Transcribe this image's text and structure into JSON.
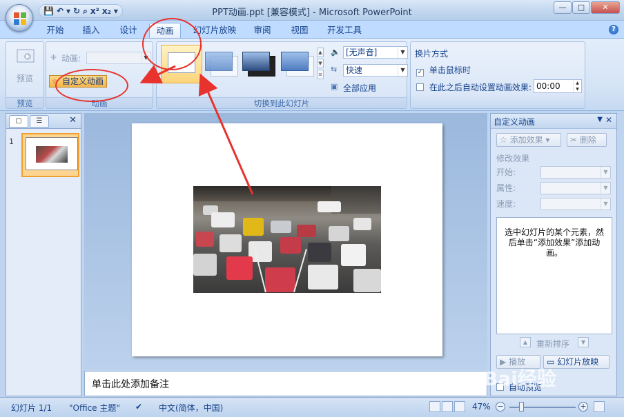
{
  "window": {
    "title": "PPT动画.ppt [兼容模式] - Microsoft PowerPoint"
  },
  "qat": {
    "items": [
      "💾",
      "↶",
      "▾",
      "↻",
      "⌕",
      "x²",
      "x₂",
      "▾"
    ]
  },
  "ribbon_tabs": [
    "开始",
    "插入",
    "设计",
    "动画",
    "幻灯片放映",
    "审阅",
    "视图",
    "开发工具"
  ],
  "active_tab": "动画",
  "preview_group": {
    "button": "预览",
    "label": "预览"
  },
  "animation_group": {
    "animate_label": "动画:",
    "custom_animation": "自定义动画",
    "label": "动画"
  },
  "transition_group": {
    "sound": "[无声音]",
    "speed": "快速",
    "apply_all": "全部应用",
    "label": "切换到此幻灯片"
  },
  "advance_group": {
    "title": "换片方式",
    "on_click": "单击鼠标时",
    "on_click_checked": true,
    "auto_after": "在此之后自动设置动画效果:",
    "auto_time": "00:00"
  },
  "slides_pane": {
    "slide_number": "1"
  },
  "notes": {
    "placeholder": "单击此处添加备注"
  },
  "task_pane": {
    "title": "自定义动画",
    "add_effect": "添加效果",
    "remove": "删除",
    "modify_title": "修改效果",
    "start_label": "开始:",
    "property_label": "属性:",
    "speed_label": "速度:",
    "hint": "选中幻灯片的某个元素，然后单击“添加效果”添加动画。",
    "reorder": "重新排序",
    "play": "播放",
    "slideshow": "幻灯片放映",
    "autopreview": "自动预览"
  },
  "statusbar": {
    "slide_info": "幻灯片 1/1",
    "theme": "\"Office 主题\"",
    "language": "中文(简体，中国)",
    "zoom": "47%"
  },
  "colors": {
    "annotation": "#e8322d",
    "ribbon": "#d4e3f6",
    "highlight": "#f0a030"
  }
}
